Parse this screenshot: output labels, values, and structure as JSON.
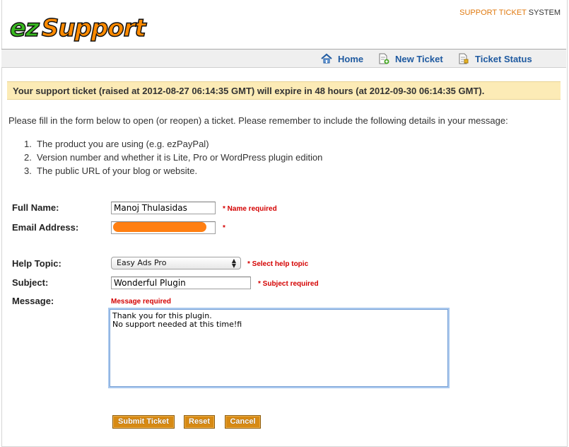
{
  "brand": {
    "logo_ez": "ez",
    "logo_support": "Support",
    "system_label_orange": "SUPPORT TICKET",
    "system_label_dark": " SYSTEM"
  },
  "nav": {
    "items": [
      {
        "label": "Home",
        "icon": "home-icon"
      },
      {
        "label": "New Ticket",
        "icon": "new-ticket-icon"
      },
      {
        "label": "Ticket Status",
        "icon": "ticket-status-icon"
      }
    ]
  },
  "notice": {
    "text": "Your support ticket (raised at 2012-08-27 06:14:35 GMT) will expire in 48 hours (at 2012-09-30 06:14:35 GMT)."
  },
  "intro": {
    "text": "Please fill in the form below to open (or reopen) a ticket. Please remember to include the following details in your message:",
    "requirements": [
      {
        "num": "1.",
        "text": "The product you are using (e.g. ezPayPal)"
      },
      {
        "num": "2.",
        "text": "Version number and whether it is Lite, Pro or WordPress plugin edition"
      },
      {
        "num": "3.",
        "text": "The public URL of your blog or website."
      }
    ]
  },
  "form": {
    "full_name": {
      "label": "Full Name:",
      "value": "Manoj Thulasidas",
      "error": "* Name required"
    },
    "email": {
      "label": "Email Address:",
      "value": "",
      "error": "*"
    },
    "help_topic": {
      "label": "Help Topic:",
      "selected": "Easy Ads Pro",
      "error": "* Select help topic"
    },
    "subject": {
      "label": "Subject:",
      "value": "Wonderful Plugin",
      "error": "* Subject required"
    },
    "message": {
      "label": "Message:",
      "error": "Message required",
      "value": "Thank you for this plugin.\nNo support needed at this time!fi"
    }
  },
  "buttons": {
    "submit": "Submit Ticket",
    "reset": "Reset",
    "cancel": "Cancel"
  },
  "colors": {
    "accent": "#d78a14",
    "link": "#1f5aa0",
    "error": "#d40000",
    "notice_bg": "#fcebb6",
    "redaction": "#ff7f12"
  }
}
